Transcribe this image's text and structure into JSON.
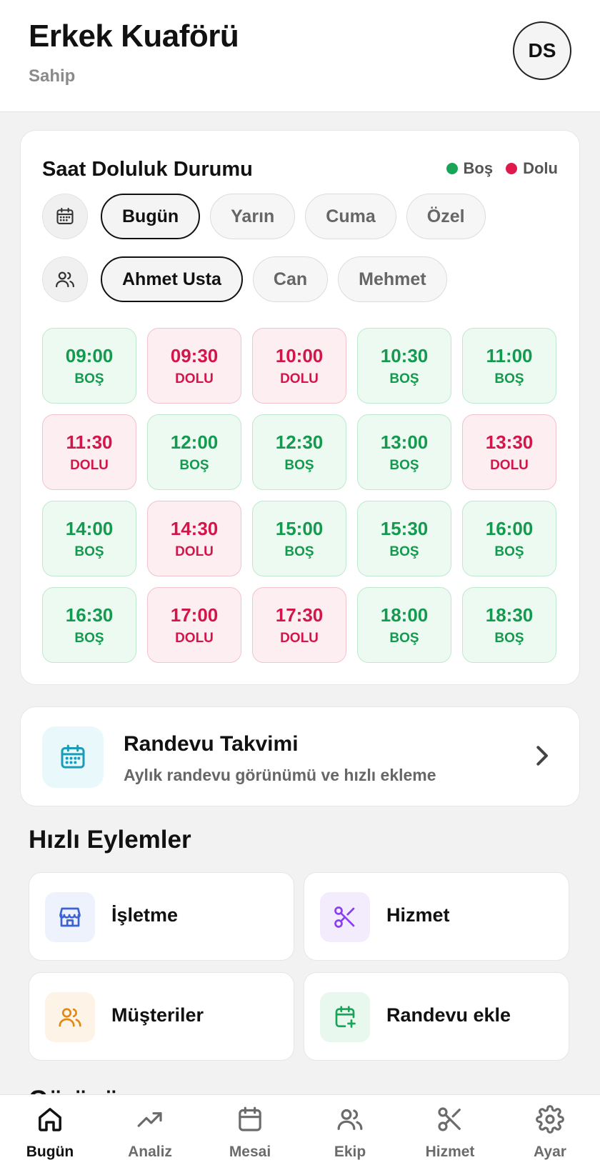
{
  "header": {
    "title": "Erkek Kuaförü",
    "role": "Sahip",
    "avatar_initials": "DS"
  },
  "occupancy": {
    "title": "Saat Doluluk Durumu",
    "legend": [
      {
        "label": "Boş",
        "color": "#18a558"
      },
      {
        "label": "Dolu",
        "color": "#e0194d"
      }
    ],
    "day_filters": [
      {
        "label": "Bugün",
        "active": true
      },
      {
        "label": "Yarın",
        "active": false
      },
      {
        "label": "Cuma",
        "active": false
      },
      {
        "label": "Özel",
        "active": false
      }
    ],
    "staff_filters": [
      {
        "label": "Ahmet Usta",
        "active": true
      },
      {
        "label": "Can",
        "active": false
      },
      {
        "label": "Mehmet",
        "active": false
      }
    ],
    "free_label": "BOŞ",
    "busy_label": "DOLU",
    "slots": [
      {
        "time": "09:00",
        "status": "free"
      },
      {
        "time": "09:30",
        "status": "busy"
      },
      {
        "time": "10:00",
        "status": "busy"
      },
      {
        "time": "10:30",
        "status": "free"
      },
      {
        "time": "11:00",
        "status": "free"
      },
      {
        "time": "11:30",
        "status": "busy"
      },
      {
        "time": "12:00",
        "status": "free"
      },
      {
        "time": "12:30",
        "status": "free"
      },
      {
        "time": "13:00",
        "status": "free"
      },
      {
        "time": "13:30",
        "status": "busy"
      },
      {
        "time": "14:00",
        "status": "free"
      },
      {
        "time": "14:30",
        "status": "busy"
      },
      {
        "time": "15:00",
        "status": "free"
      },
      {
        "time": "15:30",
        "status": "free"
      },
      {
        "time": "16:00",
        "status": "free"
      },
      {
        "time": "16:30",
        "status": "free"
      },
      {
        "time": "17:00",
        "status": "busy"
      },
      {
        "time": "17:30",
        "status": "busy"
      },
      {
        "time": "18:00",
        "status": "free"
      },
      {
        "time": "18:30",
        "status": "free"
      }
    ]
  },
  "calendar_card": {
    "title": "Randevu Takvimi",
    "subtitle": "Aylık randevu görünümü ve hızlı ekleme"
  },
  "quick_actions": {
    "title": "Hızlı Eylemler",
    "items": [
      {
        "label": "İşletme",
        "icon": "store-icon",
        "color": "#3b63d6",
        "bg": "#eef2fd"
      },
      {
        "label": "Hizmet",
        "icon": "scissors-icon",
        "color": "#8a3ff0",
        "bg": "#f3ecfd"
      },
      {
        "label": "Müşteriler",
        "icon": "users-icon",
        "color": "#e08a16",
        "bg": "#fdf3e6"
      },
      {
        "label": "Randevu ekle",
        "icon": "calendar-plus-icon",
        "color": "#18a558",
        "bg": "#e9f8ef"
      }
    ]
  },
  "peek_section_title": "Görünüm",
  "tabbar": {
    "tabs": [
      {
        "label": "Bugün",
        "icon": "home-icon",
        "active": true
      },
      {
        "label": "Analiz",
        "icon": "trend-icon",
        "active": false
      },
      {
        "label": "Mesai",
        "icon": "calendar-icon",
        "active": false
      },
      {
        "label": "Ekip",
        "icon": "team-icon",
        "active": false
      },
      {
        "label": "Hizmet",
        "icon": "scissors-icon",
        "active": false
      },
      {
        "label": "Ayar",
        "icon": "gear-icon",
        "active": false
      }
    ]
  },
  "colors": {
    "free_text": "#149a4f",
    "busy_text": "#d3164a",
    "calendar_accent": "#1a9bb8"
  }
}
